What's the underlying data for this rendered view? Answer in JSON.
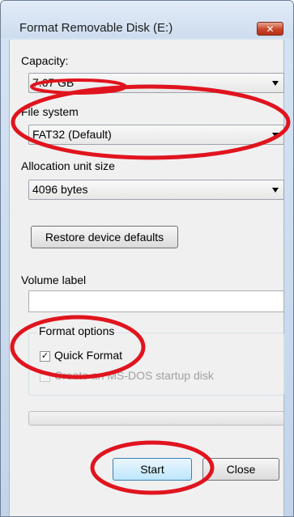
{
  "window": {
    "title": "Format Removable Disk (E:)",
    "close_glyph": "✕"
  },
  "capacity": {
    "label": "Capacity:",
    "value": "7.67 GB"
  },
  "file_system": {
    "label": "File system",
    "value": "FAT32 (Default)"
  },
  "allocation": {
    "label": "Allocation unit size",
    "value": "4096 bytes"
  },
  "restore_button": "Restore device defaults",
  "volume_label": {
    "label": "Volume label",
    "value": ""
  },
  "format_options": {
    "title": "Format options",
    "quick_format": {
      "label": "Quick Format",
      "checked": true
    },
    "msdos": {
      "label": "Create an MS-DOS startup disk",
      "checked": false,
      "enabled": false
    }
  },
  "progress": {
    "value": 0
  },
  "buttons": {
    "start": "Start",
    "close": "Close"
  },
  "icons": {
    "close": "close-icon",
    "dropdown": "chevron-down-icon",
    "check": "checkmark-icon"
  },
  "colors": {
    "annotation": "#e0141e",
    "close_button": "#c8452b",
    "title_bar": "#cddcee"
  }
}
